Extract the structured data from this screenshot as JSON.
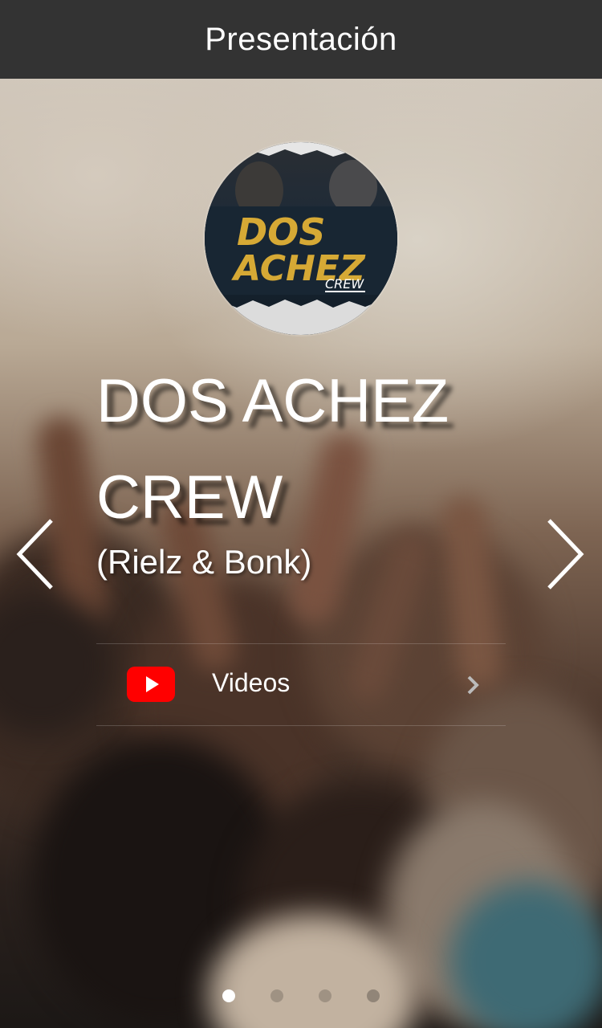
{
  "header": {
    "title": "Presentación"
  },
  "profile": {
    "avatar_alt": "DOS ACHEZ CREW logo",
    "logo_line1": "DOS",
    "logo_line2": "ACHEZ",
    "logo_line3": "CREW",
    "name_line1": "DOS ACHEZ",
    "name_line2": "CREW",
    "subtitle": "(Rielz & Bonk)"
  },
  "links": [
    {
      "icon": "youtube-icon",
      "label": "Videos"
    }
  ],
  "navigation": {
    "prev_icon": "chevron-left-icon",
    "next_icon": "chevron-right-icon"
  },
  "pager": {
    "total": 4,
    "active_index": 0
  },
  "colors": {
    "header_bg": "#333333",
    "youtube_red": "#ff0000",
    "text": "#ffffff"
  }
}
